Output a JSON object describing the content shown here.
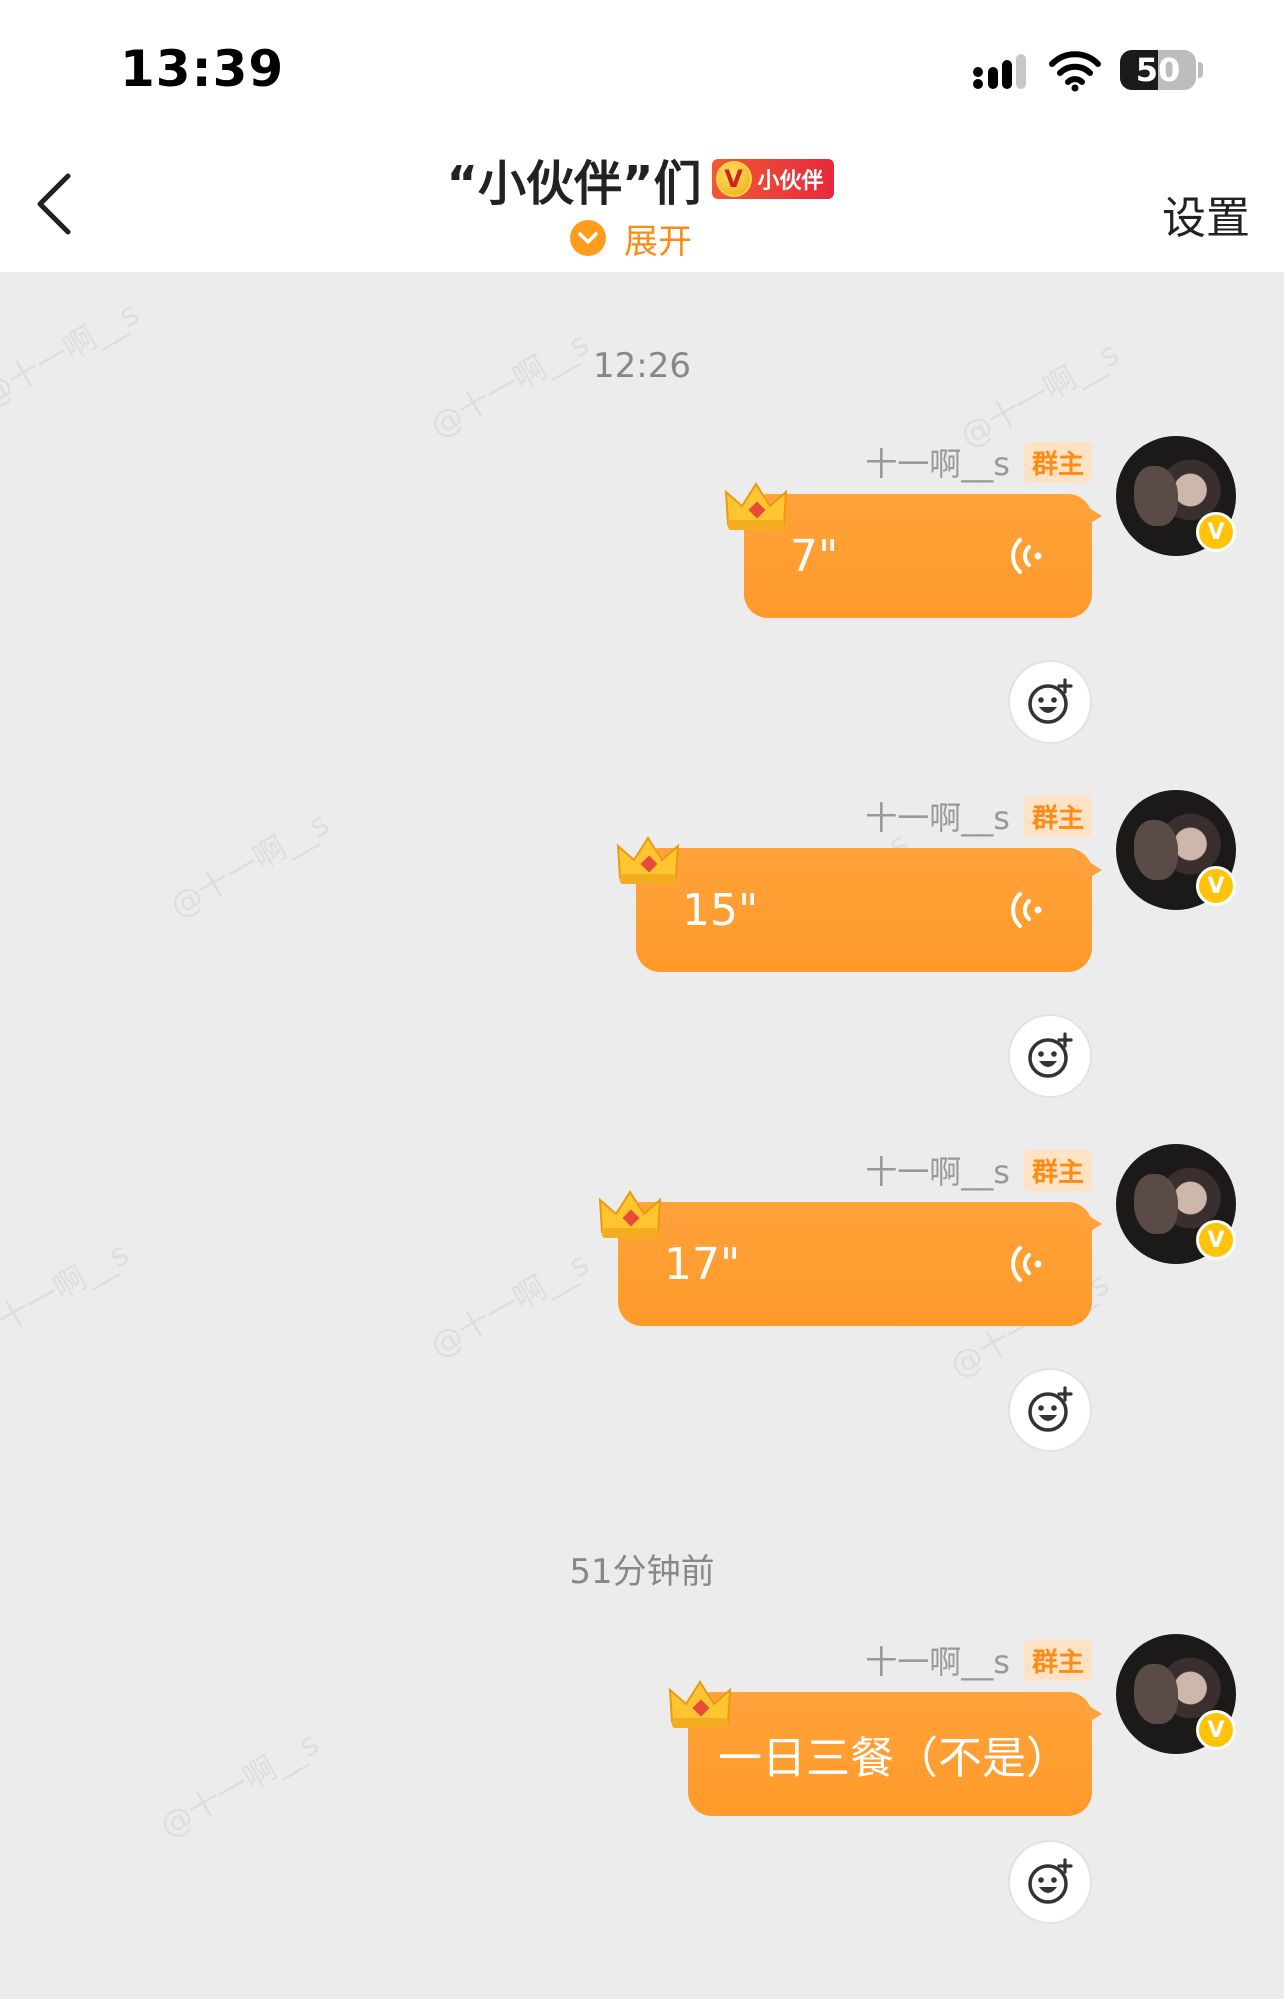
{
  "status_bar": {
    "time": "13:39",
    "battery": "50",
    "battery_level": 0.5
  },
  "header": {
    "title": "“小伙伴”们",
    "badge_v": "V",
    "badge_label": "小伙伴",
    "expand_label": "展开",
    "settings_label": "设置"
  },
  "watermark_text": "@十一啊__s",
  "chat": {
    "time_separators": [
      "12:26",
      "51分钟前"
    ],
    "messages": [
      {
        "sender": "十一啊__s",
        "role_tag": "群主",
        "type": "voice",
        "text": "7\""
      },
      {
        "sender": "十一啊__s",
        "role_tag": "群主",
        "type": "voice",
        "text": "15\""
      },
      {
        "sender": "十一啊__s",
        "role_tag": "群主",
        "type": "voice",
        "text": "17\""
      },
      {
        "sender": "十一啊__s",
        "role_tag": "群主",
        "type": "text",
        "text": "一日三餐（不是）"
      }
    ],
    "avatar_badge": "V"
  },
  "colors": {
    "bubble": "#ffa23a",
    "accent": "#ff8a14",
    "header_bg": "#ffffff",
    "chat_bg": "#ececec"
  },
  "icons": [
    "back-chevron-icon",
    "signal-icon",
    "wifi-icon",
    "battery-icon",
    "expand-chevron-icon",
    "crown-icon",
    "voice-wave-icon",
    "add-reaction-icon",
    "verified-icon"
  ]
}
